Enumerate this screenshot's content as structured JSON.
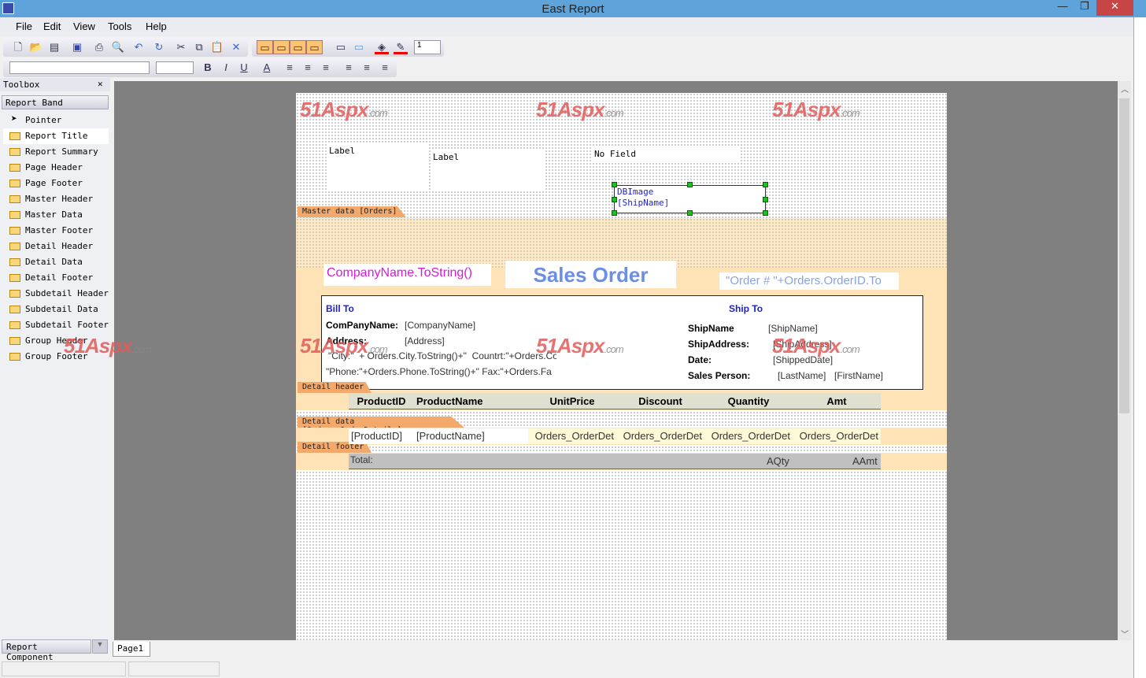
{
  "window": {
    "title": "East Report",
    "minimize": "—",
    "maximize": "❐",
    "close": "✕"
  },
  "menu": [
    "File",
    "Edit",
    "View",
    "Tools",
    "Help"
  ],
  "toolbar": {
    "line_width_value": "1"
  },
  "toolbox": {
    "title": "Toolbox",
    "close": "✕",
    "group": "Report Band",
    "pointer": "Pointer",
    "items": [
      "Report Title",
      "Report Summary",
      "Page Header",
      "Page Footer",
      "Master Header",
      "Master Data",
      "Master Footer",
      "Detail Header",
      "Detail Data",
      "Detail Footer",
      "Subdetail Header",
      "Subdetail Data",
      "Subdetail Footer",
      "Group Header",
      "Group Footer"
    ],
    "component_tab": "Report Component"
  },
  "watermark": {
    "text": "51Aspx",
    "suffix": ".com"
  },
  "report": {
    "labels": [
      "Label",
      "Label",
      "No Field"
    ],
    "dbimage": [
      "DBImage",
      "[ShipName]"
    ],
    "bands": {
      "master": "Master data [Orders]",
      "detail_header": "Detail header",
      "detail_data": "Detail data [Orders_OrderDetails]",
      "detail_footer": "Detail footer"
    },
    "company": "CompanyName.ToString()",
    "title": "Sales Order",
    "order_no": "\"Order # \"+Orders.OrderID.To",
    "bill_to": "Bill To",
    "ship_to": "Ship To",
    "company_label": "ComPanyName:",
    "company_field": "[CompanyName]",
    "address_label": "Address:",
    "address_field": "[Address]",
    "city_expr": "\"City:\"  + Orders.City.ToString()+\"  Countrt:\"+Orders.Co",
    "phone_expr": "\"Phone:\"+Orders.Phone.ToString()+\" Fax:\"+Orders.Fa",
    "ship_labels": [
      "ShipName",
      "ShipAddress:",
      "Date:",
      "Sales Person:"
    ],
    "ship_fields": [
      "[ShipName]",
      "[ShipAddress]",
      "[ShippedDate]",
      "[LastName]",
      "[FirstName]"
    ],
    "columns": [
      "ProductID",
      "ProductName",
      "UnitPrice",
      "Discount",
      "Quantity",
      "Amt"
    ],
    "detail_fields": [
      "[ProductID]",
      "[ProductName]",
      "Orders_OrderDet",
      "Orders_OrderDet",
      "Orders_OrderDet",
      "Orders_OrderDet"
    ],
    "total_label": "Total:",
    "total_qty": "AQty",
    "total_amt": "AAmt"
  },
  "page_tab": "Page1"
}
